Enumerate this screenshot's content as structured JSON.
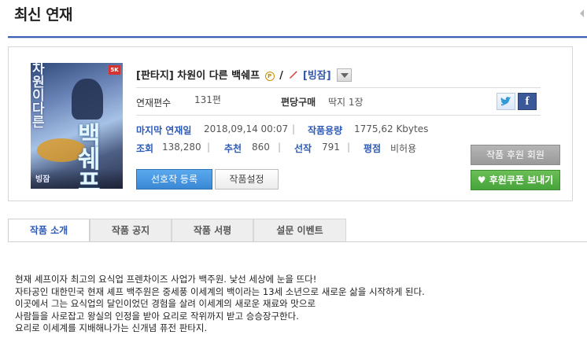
{
  "section": {
    "title": "최신 연재"
  },
  "work": {
    "genre": "[판타지]",
    "title": "차원이 다른 백쉐프",
    "separator": "/",
    "author": "[빙잠]",
    "cover": {
      "badge": "5K",
      "title_top": "차\n원\n이\n다\n른",
      "title_main": "백\n쉐\n프",
      "logo": "빙잠"
    }
  },
  "info": {
    "episodes_label": "연재편수",
    "episodes_value": "131편",
    "sale_label": "편당구매",
    "sale_value": "딱지 1장",
    "last_update_label": "마지막 연재일",
    "last_update_value": "2018,09,14 00:07",
    "size_label": "작품용량",
    "size_value": "1775,62 Kbytes",
    "views_label": "조회",
    "views_value": "138,280",
    "recommend_label": "추천",
    "recommend_value": "860",
    "preferred_label": "선작",
    "preferred_value": "791",
    "rating_label": "평점",
    "rating_value": "비허용"
  },
  "buttons": {
    "favorite": "선호작 등록",
    "settings": "작품설정",
    "sponsor_members": "작품 후원 회원",
    "send_coupon": "후원쿠폰 보내기"
  },
  "tabs": [
    {
      "label": "작품 소개",
      "active": true
    },
    {
      "label": "작품 공지",
      "active": false
    },
    {
      "label": "작품 서평",
      "active": false
    },
    {
      "label": "설문 이벤트",
      "active": false
    }
  ],
  "description": [
    "현재 셰프이자 최고의 요식업 프렌차이즈 사업가 백주원. 낯선 세상에 눈을 뜨다!",
    "자타공인 대한민국 현재 셰프 백주원은 중세풍 이세계의 백이라는 13세 소년으로 새로운 삶을 시작하게 된다.",
    "이곳에서 그는 요식업의 달인이었던 경험을 살려 이세계의 새로운 재료와 맛으로",
    "사람들을 사로잡고 왕실의 인정을 받아 요리로 작위까지 받고 승승장구한다.",
    "요리로 이세계를 지배해나가는 신개념 퓨전 판타지."
  ],
  "colors": {
    "accent_blue": "#3b62b8",
    "link_blue": "#2d5ab4",
    "facebook": "#3b5998",
    "green_button": "#47a33b"
  },
  "icons": [
    "premium-p-icon",
    "pencil-icon",
    "dropdown-icon",
    "twitter-icon",
    "facebook-icon",
    "heart-icon"
  ]
}
